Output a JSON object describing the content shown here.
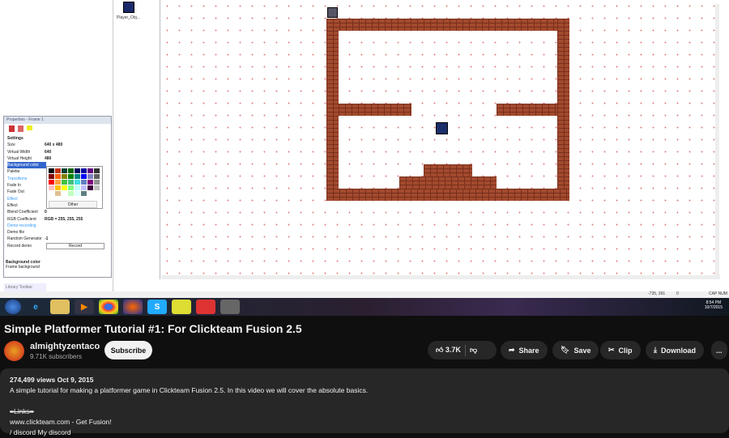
{
  "video": {
    "object_label": "Player_Obj...",
    "properties": {
      "title": "Properties - Frame 1",
      "rows": [
        {
          "label": "Settings",
          "type": "head"
        },
        {
          "label": "Size",
          "value": "640 x 480"
        },
        {
          "label": "Virtual Width",
          "value": "640"
        },
        {
          "label": "Virtual Height",
          "value": "480"
        },
        {
          "label": "Background color",
          "type": "sel"
        },
        {
          "label": "Palette"
        },
        {
          "label": "Transitions",
          "type": "cat"
        },
        {
          "label": "Fade In"
        },
        {
          "label": "Fade Out"
        },
        {
          "label": "Effect",
          "type": "cat"
        },
        {
          "label": "Effect"
        },
        {
          "label": "Blend Coefficient",
          "value": "0"
        },
        {
          "label": "RGB Coefficient",
          "value": "RGB = 255, 255, 255"
        },
        {
          "label": "Demo recording",
          "type": "cat"
        },
        {
          "label": "Demo file"
        },
        {
          "label": "Random Generator",
          "value": "-1"
        },
        {
          "label": "Record demo",
          "value": "Record"
        }
      ],
      "help_title": "Background color",
      "help_text": "Frame background",
      "palette_other": "Other",
      "palette": [
        "#000000",
        "#c03010",
        "#004030",
        "#006000",
        "#000060",
        "#0000a0",
        "#600080",
        "#303030",
        "#800000",
        "#ff6000",
        "#808000",
        "#008000",
        "#008080",
        "#0000ff",
        "#8080c0",
        "#606060",
        "#ff0000",
        "#ffa040",
        "#40c040",
        "#40c080",
        "#40e0e0",
        "#6080c0",
        "#800080",
        "#909090",
        "#ffc0c0",
        "#ffc000",
        "#ffff00",
        "#80ff80",
        "#c0ffff",
        "#c0c0ff",
        "#400040",
        "#c0c0c0",
        "#ffffff",
        "#e0c090",
        "#ffffff",
        "#c0ffc0",
        "#e0ffff",
        "#608080",
        "#ffffff",
        "#ffffff"
      ]
    },
    "library_tab": "Library Toolbar",
    "status": {
      "coords": "-735, 391",
      "layer": "0",
      "caps": "CAP NUM"
    },
    "clock": {
      "time": "8:54 PM",
      "date": "10/7/2015"
    }
  },
  "title": "Simple Platformer Tutorial #1: For Clickteam Fusion 2.5",
  "channel": {
    "name": "almightyzentaco",
    "subscribers": "9.71K subscribers",
    "subscribe": "Subscribe"
  },
  "actions": {
    "likes": "3.7K",
    "share": "Share",
    "save": "Save",
    "clip": "Clip",
    "download": "Download",
    "more": "..."
  },
  "description": {
    "meta": "274,499 views  Oct 9, 2015",
    "text": "A simple tutorial for making a platformer game in Clickteam Fusion 2.5. In this video we will cover the absolute basics.",
    "links_head": "=Links=",
    "link1": "www.clickteam.com - Get Fusion!",
    "link2": "/ discord    My discord"
  }
}
